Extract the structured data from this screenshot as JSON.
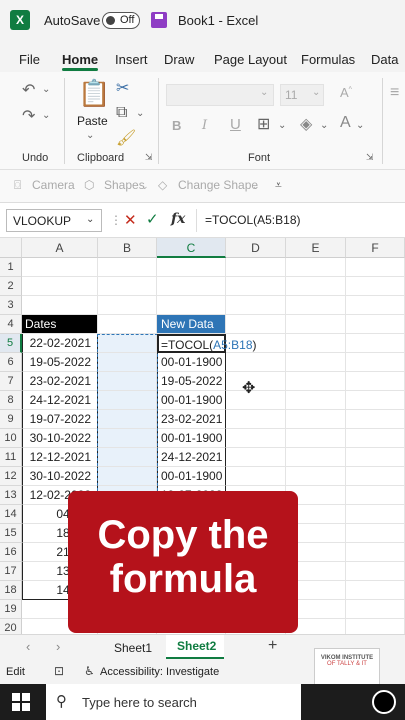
{
  "titlebar": {
    "autosave_label": "AutoSave",
    "autosave_state": "Off",
    "doc_title": "Book1  -  Excel"
  },
  "menu": {
    "tabs": [
      "File",
      "Home",
      "Insert",
      "Draw",
      "Page Layout",
      "Formulas",
      "Data"
    ]
  },
  "ribbon": {
    "undo_label": "Undo",
    "clipboard_label": "Clipboard",
    "paste_label": "Paste",
    "font_label": "Font",
    "font_size": "11",
    "bold": "B",
    "italic": "I"
  },
  "shapes_row": {
    "camera": "Camera",
    "shapes": "Shapes",
    "change_shape": "Change Shape"
  },
  "formula_bar": {
    "name_box": "VLOOKUP",
    "formula": "=TOCOL(A5:B18)"
  },
  "columns": [
    "A",
    "B",
    "C",
    "D",
    "E",
    "F"
  ],
  "rows": [
    "1",
    "2",
    "3",
    "4",
    "5",
    "6",
    "7",
    "8",
    "9",
    "10",
    "11",
    "12",
    "13",
    "14",
    "15",
    "16",
    "17",
    "18",
    "19",
    "20"
  ],
  "table": {
    "header_a": "Dates",
    "header_c": "New Data",
    "dates_a": [
      "22-02-2021",
      "19-05-2022",
      "23-02-2021",
      "24-12-2021",
      "19-07-2022",
      "30-10-2022",
      "12-12-2021",
      "30-10-2022",
      "12-02-2022",
      "04-01-",
      "18-03-",
      "21-01-",
      "13-07-",
      "14-10-"
    ],
    "formula_prefix": "=TOCOL(",
    "formula_ref": "A5:B18",
    "formula_suffix": ")",
    "new_data_c": [
      "00-01-1900",
      "19-05-2022",
      "00-01-1900",
      "23-02-2021",
      "00-01-1900",
      "24-12-2021",
      "00-01-1900",
      "19-07-2022"
    ]
  },
  "caption": {
    "line1": "Copy the",
    "line2": "formula"
  },
  "sheets": {
    "tabs": [
      "Sheet1",
      "Sheet2"
    ],
    "active": "Sheet2",
    "add": "+"
  },
  "status": {
    "mode": "Edit",
    "accessibility": "Accessibility: Investigate"
  },
  "watermark": {
    "line1": "VIKOM INSTITUTE",
    "line2": "OF TALLY & IT"
  },
  "taskbar": {
    "search_placeholder": "Type here to search"
  },
  "colors": {
    "excel_green": "#107c41",
    "header_blue": "#2e75b6",
    "caption_red": "#b5121b"
  }
}
